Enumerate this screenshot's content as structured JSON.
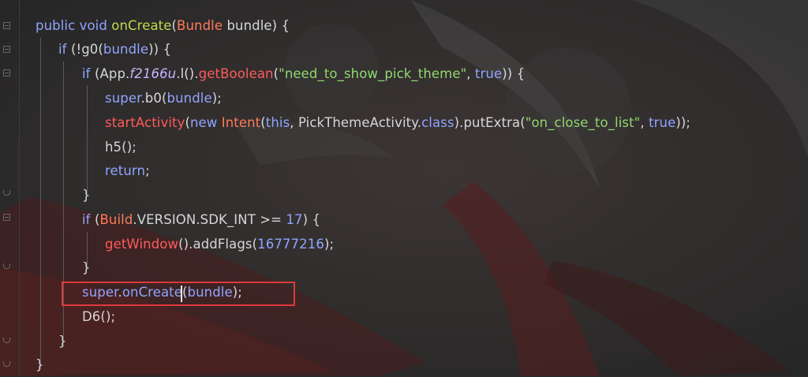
{
  "lines": [
    [
      "public",
      "void",
      "onCreate",
      "(",
      "Bundle",
      "bundle",
      ") {"
    ],
    [
      "if",
      "(!g0(",
      "bundle",
      ")) {"
    ],
    [
      "if",
      "(App.",
      "f2166u",
      ".l().",
      "getBoolean",
      "(",
      "\"need_to_show_pick_theme\"",
      ", ",
      "true",
      ")) {"
    ],
    [
      "super",
      ".b0(",
      "bundle",
      ");"
    ],
    [
      "startActivity",
      "(",
      "new",
      "Intent",
      "(",
      "this",
      ", PickThemeActivity.",
      "class",
      ").putExtra(",
      "\"on_close_to_list\"",
      ", ",
      "true",
      "));"
    ],
    [
      "h5();"
    ],
    [
      "return",
      ";"
    ],
    [
      "}"
    ],
    [
      "if",
      "(",
      "Build",
      ".VERSION.SDK_INT >= ",
      "17",
      ") {"
    ],
    [
      "getWindow",
      "().addFlags(",
      "16777216",
      ");"
    ],
    [
      "}"
    ],
    [
      "super",
      ".",
      "onCreate",
      "(",
      "bundle",
      ");"
    ],
    [
      "D6();"
    ],
    [
      "}"
    ],
    [
      "}"
    ]
  ],
  "colors": {
    "keyword": "#8fa5ff",
    "method": "#c2d84c",
    "type": "#ff7b5a",
    "string": "#8fd96d",
    "highlight_box": "#e0393a"
  },
  "highlight": {
    "line_index": 11,
    "text": "super.onCreate(bundle);"
  }
}
